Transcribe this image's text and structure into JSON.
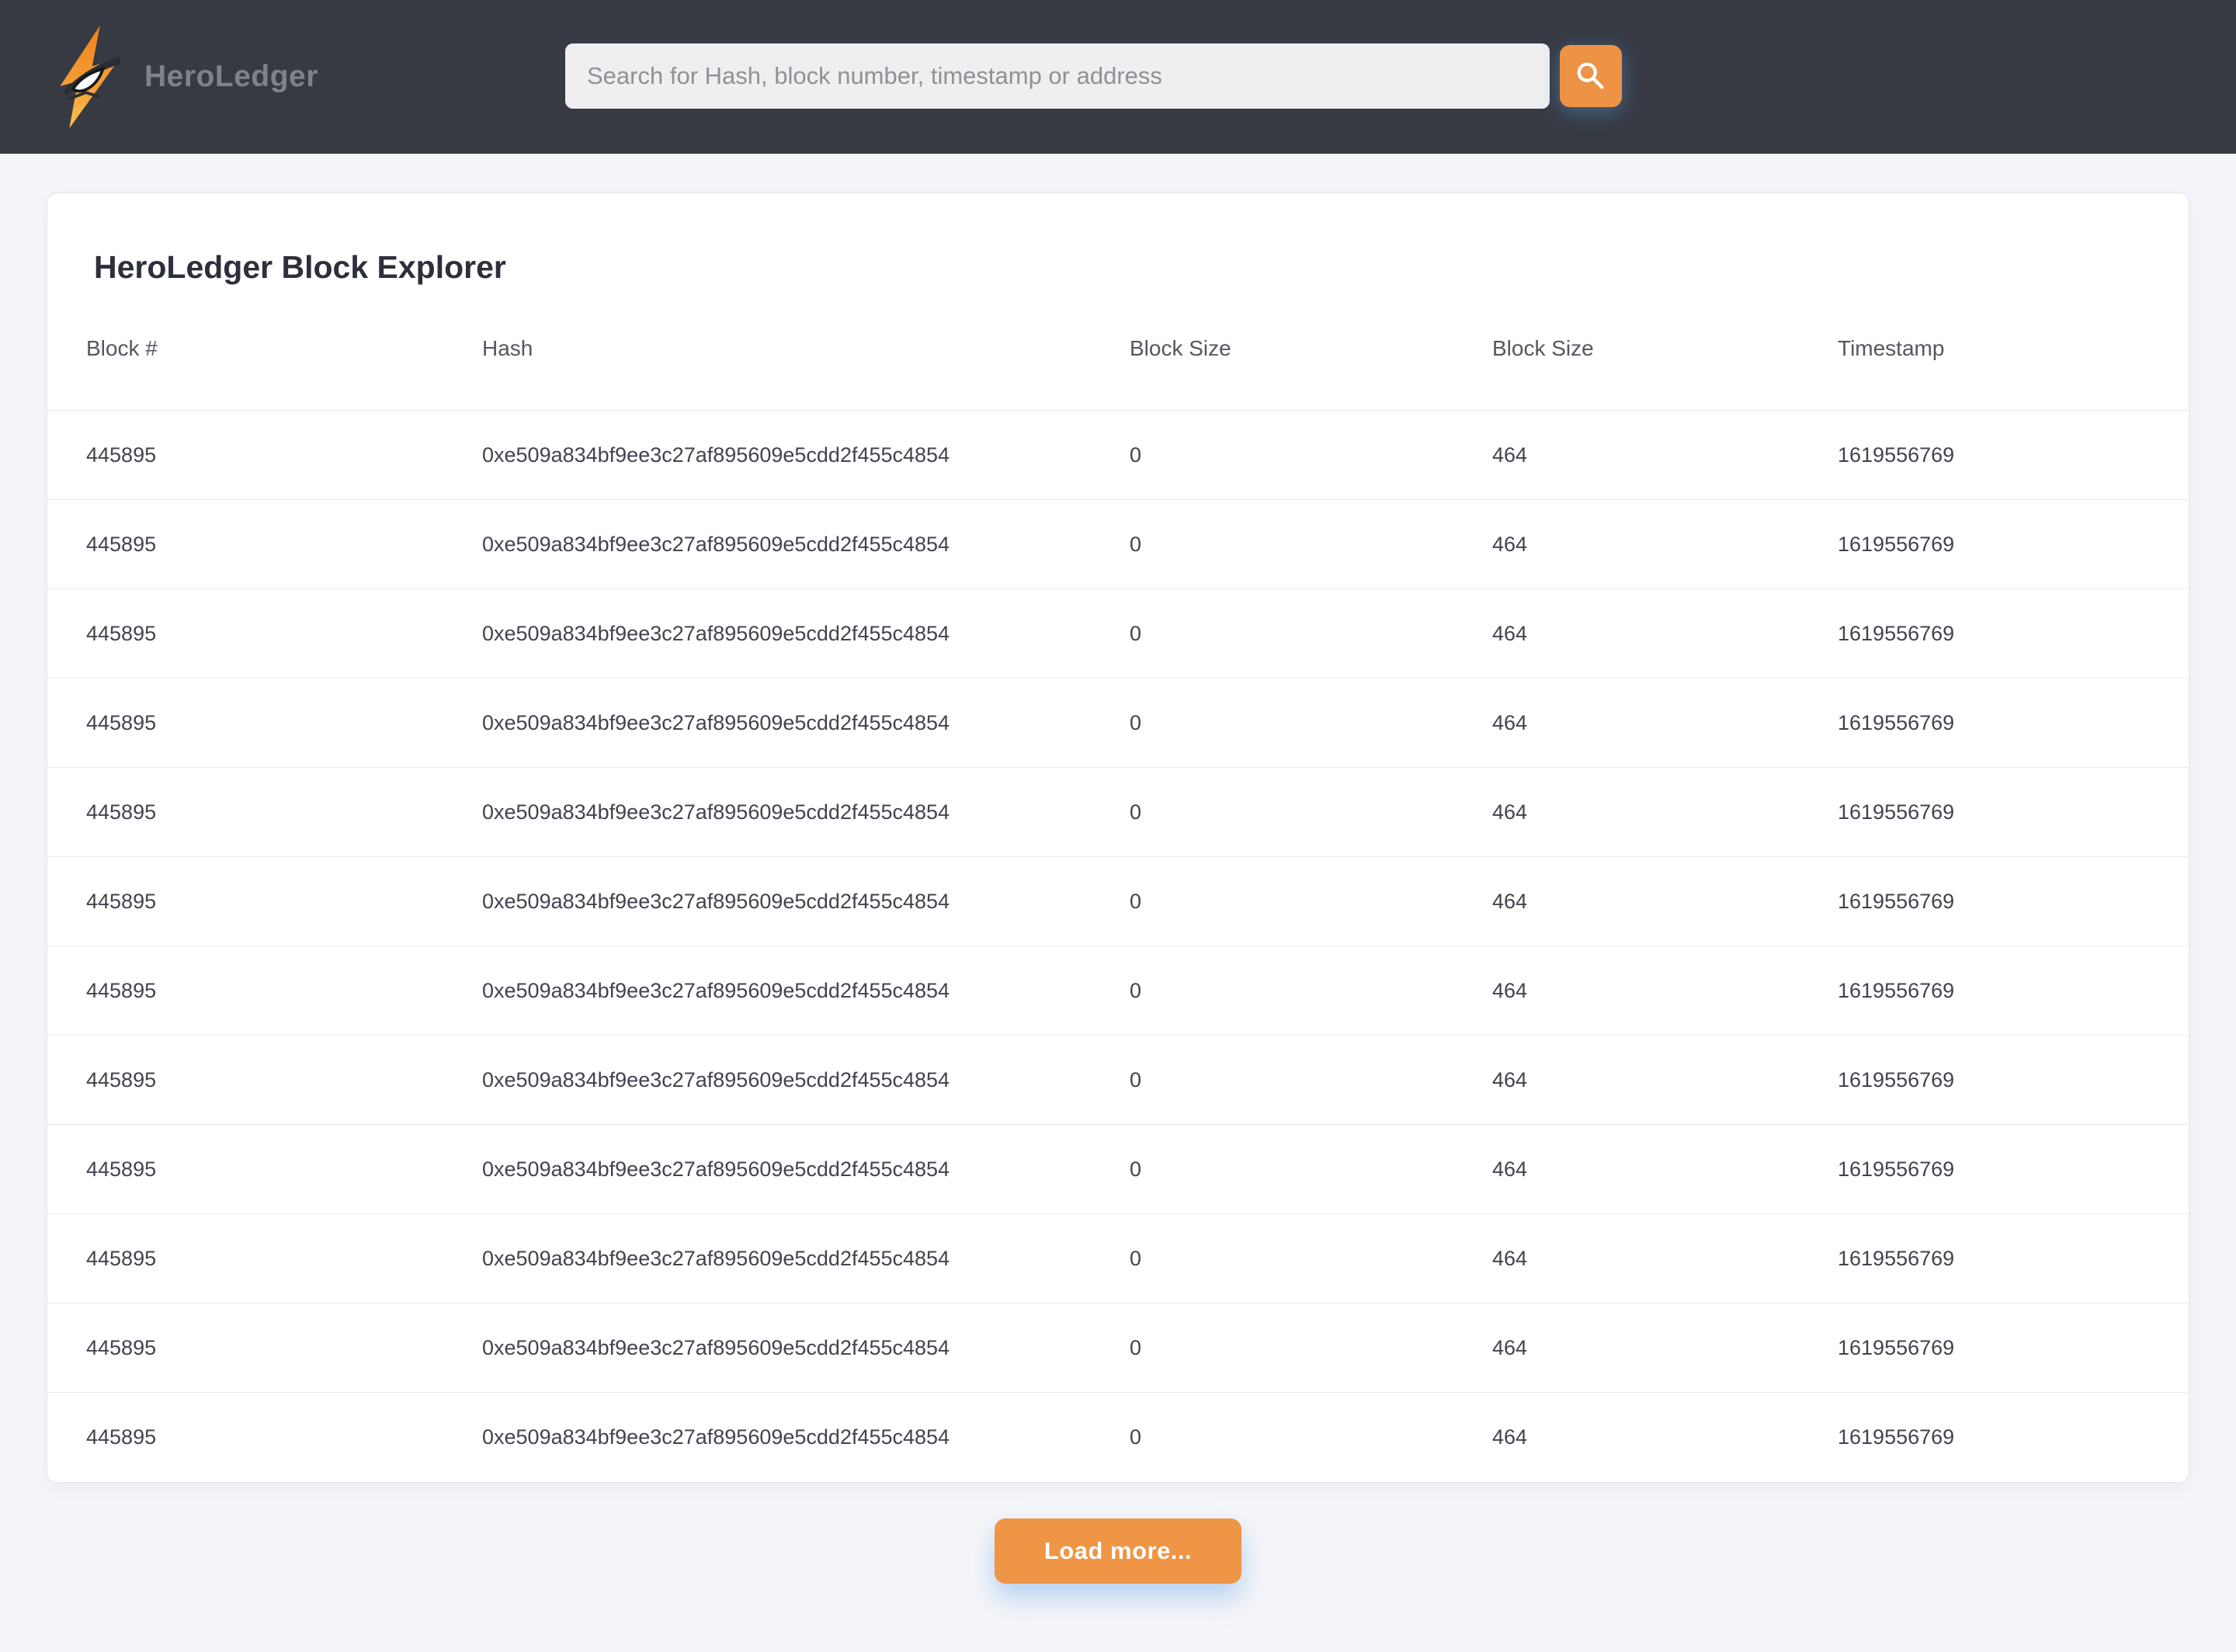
{
  "header": {
    "brand": "HeroLedger",
    "search": {
      "placeholder": "Search for Hash, block number, timestamp or address",
      "value": ""
    }
  },
  "explorer": {
    "title": "HeroLedger Block Explorer",
    "columns": [
      "Block #",
      "Hash",
      "Block Size",
      "Block Size",
      "Timestamp"
    ],
    "rows": [
      {
        "block": "445895",
        "hash": "0xe509a834bf9ee3c27af895609e5cdd2f455c4854",
        "size_a": "0",
        "size_b": "464",
        "timestamp": "1619556769"
      },
      {
        "block": "445895",
        "hash": "0xe509a834bf9ee3c27af895609e5cdd2f455c4854",
        "size_a": "0",
        "size_b": "464",
        "timestamp": "1619556769"
      },
      {
        "block": "445895",
        "hash": "0xe509a834bf9ee3c27af895609e5cdd2f455c4854",
        "size_a": "0",
        "size_b": "464",
        "timestamp": "1619556769"
      },
      {
        "block": "445895",
        "hash": "0xe509a834bf9ee3c27af895609e5cdd2f455c4854",
        "size_a": "0",
        "size_b": "464",
        "timestamp": "1619556769"
      },
      {
        "block": "445895",
        "hash": "0xe509a834bf9ee3c27af895609e5cdd2f455c4854",
        "size_a": "0",
        "size_b": "464",
        "timestamp": "1619556769"
      },
      {
        "block": "445895",
        "hash": "0xe509a834bf9ee3c27af895609e5cdd2f455c4854",
        "size_a": "0",
        "size_b": "464",
        "timestamp": "1619556769"
      },
      {
        "block": "445895",
        "hash": "0xe509a834bf9ee3c27af895609e5cdd2f455c4854",
        "size_a": "0",
        "size_b": "464",
        "timestamp": "1619556769"
      },
      {
        "block": "445895",
        "hash": "0xe509a834bf9ee3c27af895609e5cdd2f455c4854",
        "size_a": "0",
        "size_b": "464",
        "timestamp": "1619556769"
      },
      {
        "block": "445895",
        "hash": "0xe509a834bf9ee3c27af895609e5cdd2f455c4854",
        "size_a": "0",
        "size_b": "464",
        "timestamp": "1619556769"
      },
      {
        "block": "445895",
        "hash": "0xe509a834bf9ee3c27af895609e5cdd2f455c4854",
        "size_a": "0",
        "size_b": "464",
        "timestamp": "1619556769"
      },
      {
        "block": "445895",
        "hash": "0xe509a834bf9ee3c27af895609e5cdd2f455c4854",
        "size_a": "0",
        "size_b": "464",
        "timestamp": "1619556769"
      },
      {
        "block": "445895",
        "hash": "0xe509a834bf9ee3c27af895609e5cdd2f455c4854",
        "size_a": "0",
        "size_b": "464",
        "timestamp": "1619556769"
      }
    ],
    "load_more_label": "Load more..."
  },
  "colors": {
    "accent_orange": "#ee9245",
    "header_bg": "#373a43",
    "page_bg": "#f4f5f9",
    "row_border": "#e9e9f1"
  }
}
